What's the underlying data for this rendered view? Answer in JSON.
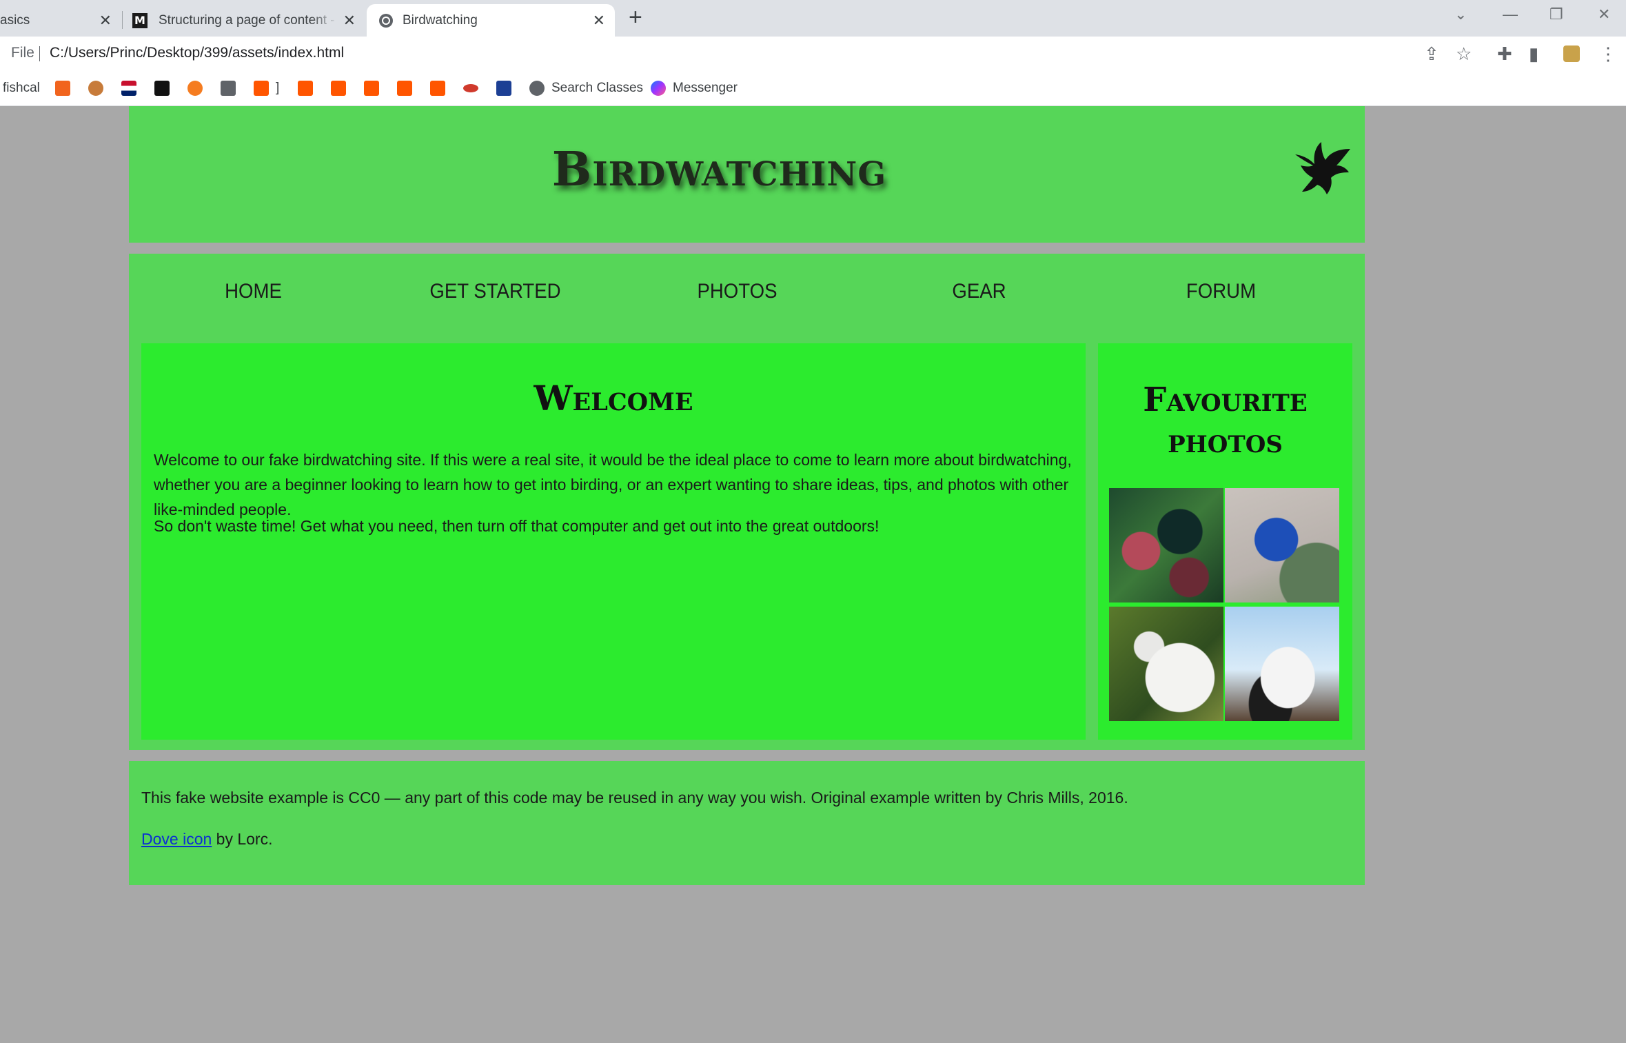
{
  "browser": {
    "tabs": [
      {
        "title": "asics"
      },
      {
        "title": "Structuring a page of content - Le"
      },
      {
        "title": "Birdwatching"
      }
    ],
    "address": {
      "label": "File",
      "url": "C:/Users/Princ/Desktop/399/assets/index.html"
    },
    "bookmarks": [
      {
        "label": "fishcal"
      },
      {
        "label": "]"
      },
      {
        "label": "Search Classes"
      },
      {
        "label": "Messenger"
      }
    ]
  },
  "site": {
    "title": "Birdwatching",
    "nav": [
      "HOME",
      "GET STARTED",
      "PHOTOS",
      "GEAR",
      "FORUM"
    ],
    "article": {
      "heading": "Welcome",
      "paragraphs": [
        "Welcome to our fake birdwatching site. If this were a real site, it would be the ideal place to come to learn more about birdwatching, whether you are a beginner looking to learn how to get into birding, or an expert wanting to share ideas, tips, and photos with other like-minded people.",
        "So don't waste time! Get what you need, then turn off that computer and get out into the great outdoors!"
      ]
    },
    "aside": {
      "heading": "Favourite photos"
    },
    "footer": {
      "license": "This fake website example is CC0 — any part of this code may be reused in any way you wish. Original example written by Chris Mills, 2016.",
      "credit_link": "Dove icon",
      "credit_rest": " by Lorc."
    }
  },
  "colors": {
    "page_bg": "#a8a8a8",
    "panel": "#56d658",
    "content": "#2ceb2e"
  }
}
